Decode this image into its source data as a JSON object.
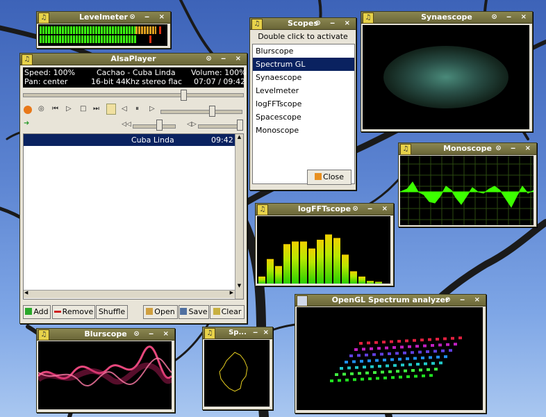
{
  "levelmeter": {
    "title": "Levelmeter"
  },
  "alsaplayer": {
    "title": "AlsaPlayer",
    "speed": "Speed: 100%",
    "song": "Cachao - Cuba Linda",
    "volume": "Volume: 100%",
    "pan": "Pan: center",
    "format": "16-bit 44Khz stereo flac",
    "time": "07:07 / 09:42",
    "progress": 0.73,
    "playlist": [
      {
        "title": "Cuba Linda",
        "duration": "09:42"
      }
    ],
    "buttons": {
      "add": "Add",
      "remove": "Remove",
      "shuffle": "Shuffle",
      "open": "Open",
      "save": "Save",
      "clear": "Clear"
    }
  },
  "scopes": {
    "title": "Scopes",
    "hint": "Double click to activate",
    "items": [
      "Blurscope",
      "Spectrum GL",
      "Synaescope",
      "Levelmeter",
      "logFFTscope",
      "Spacescope",
      "Monoscope"
    ],
    "selected": "Spectrum GL",
    "close": "Close"
  },
  "synaescope": {
    "title": "Synaescope"
  },
  "monoscope": {
    "title": "Monoscope"
  },
  "logfftscope": {
    "title": "logFFTscope"
  },
  "opengl": {
    "title": "OpenGL Spectrum analyzer"
  },
  "blurscope": {
    "title": "Blurscope"
  },
  "spacescope": {
    "title": "Sp..."
  },
  "colors": {
    "titlebar": "#7a7644",
    "selection": "#0a2260",
    "scope_green": "#3cff00",
    "blur_pink": "#ff4f8a"
  }
}
